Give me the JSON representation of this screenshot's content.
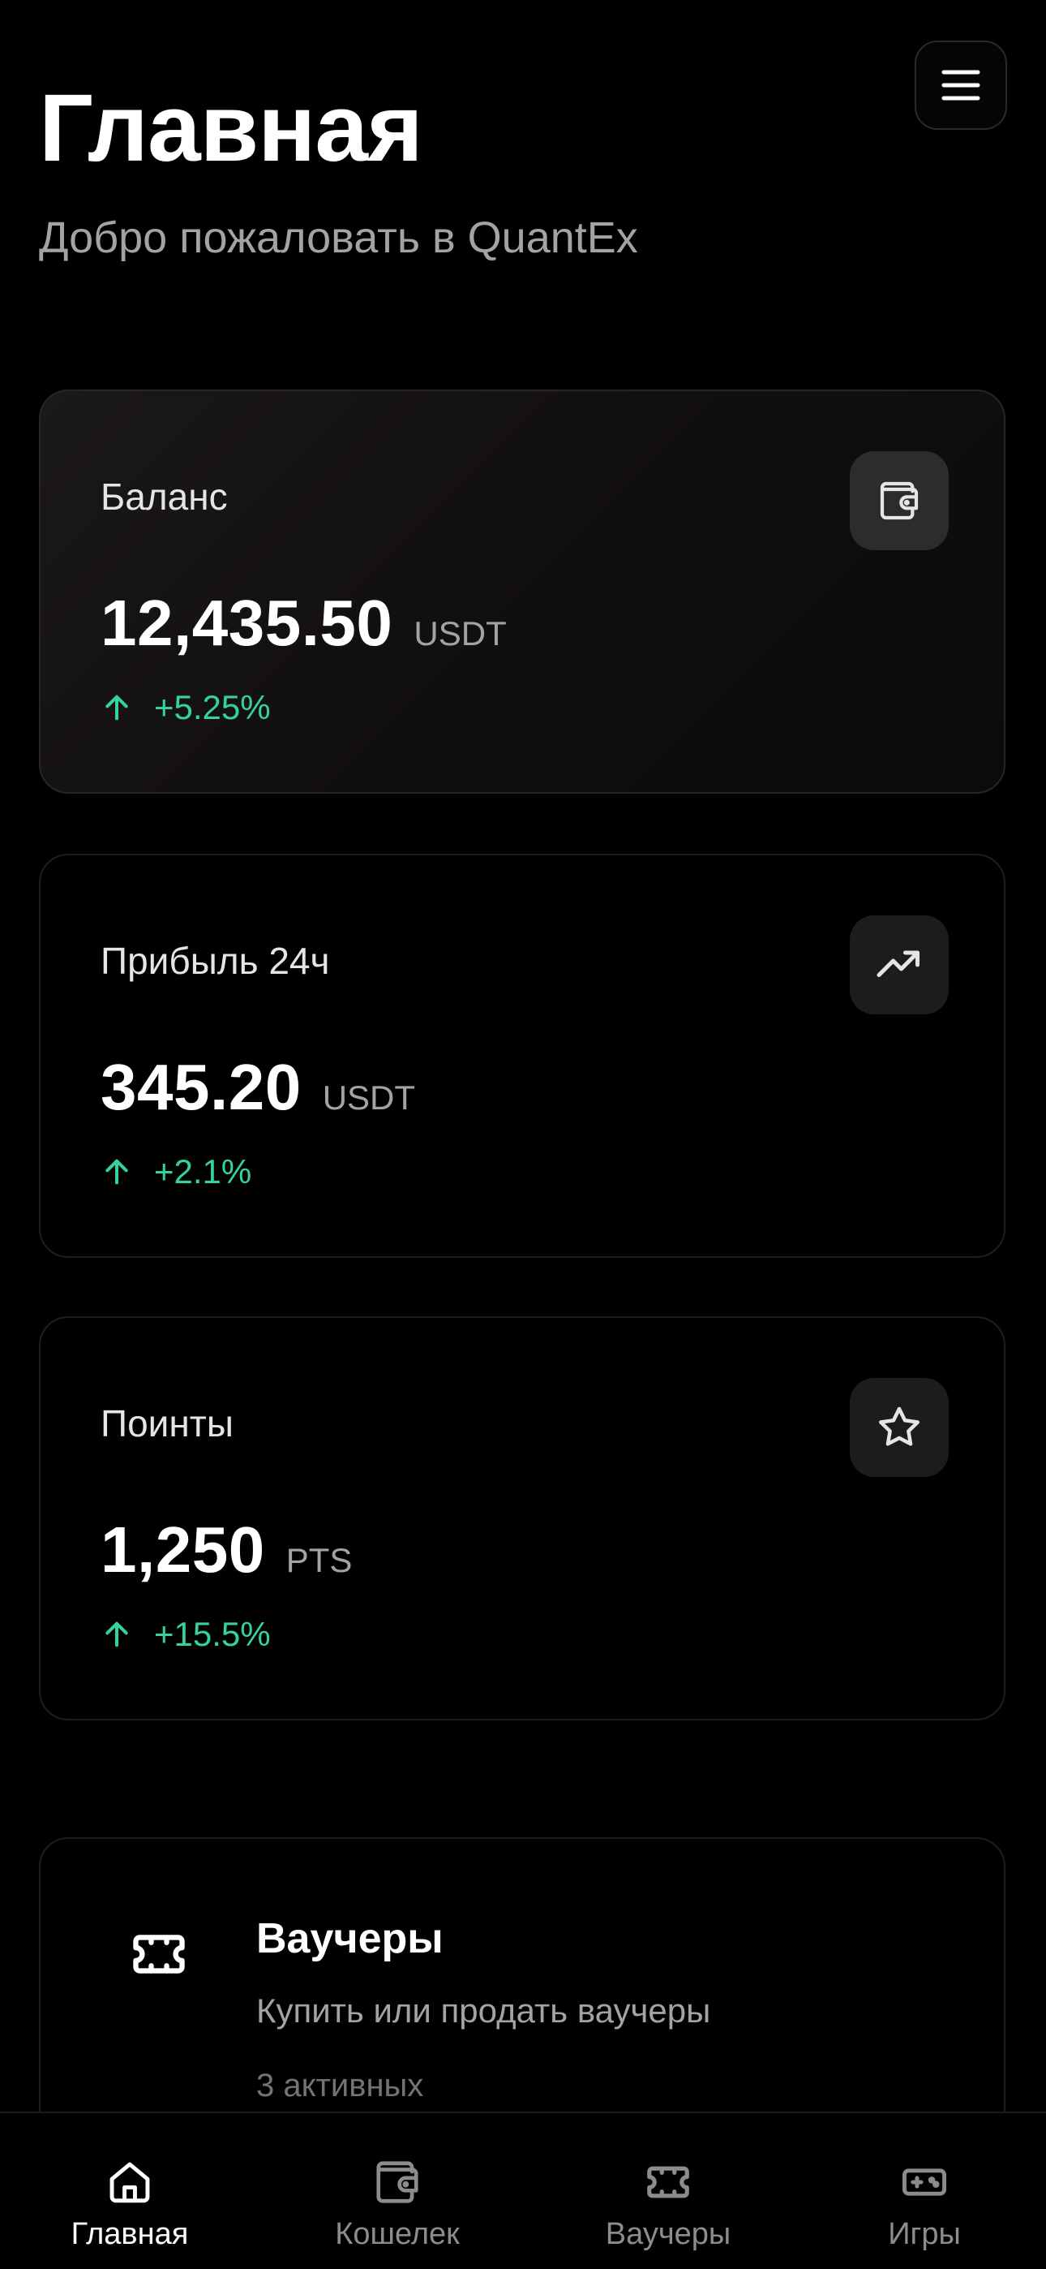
{
  "header": {
    "title": "Главная",
    "subtitle": "Добро пожаловать в QuantEx",
    "menu_icon": "menu-icon"
  },
  "cards": [
    {
      "label": "Баланс",
      "value": "12,435.50",
      "unit": "USDT",
      "change": "+5.25%",
      "icon": "wallet-icon"
    },
    {
      "label": "Прибыль 24ч",
      "value": "345.20",
      "unit": "USDT",
      "change": "+2.1%",
      "icon": "trending-up-icon"
    },
    {
      "label": "Поинты",
      "value": "1,250",
      "unit": "PTS",
      "change": "+15.5%",
      "icon": "star-icon"
    }
  ],
  "vouchers": {
    "title": "Ваучеры",
    "description": "Купить или продать ваучеры",
    "count": "3 активных",
    "icon": "ticket-icon"
  },
  "bottom_nav": {
    "items": [
      {
        "label": "Главная",
        "icon": "home-icon",
        "active": true
      },
      {
        "label": "Кошелек",
        "icon": "wallet-icon",
        "active": false
      },
      {
        "label": "Ваучеры",
        "icon": "ticket-icon",
        "active": false
      },
      {
        "label": "Игры",
        "icon": "gamepad-icon",
        "active": false
      }
    ]
  },
  "colors": {
    "background": "#000000",
    "positive": "#34d399",
    "muted_text": "#a3a3a3"
  }
}
